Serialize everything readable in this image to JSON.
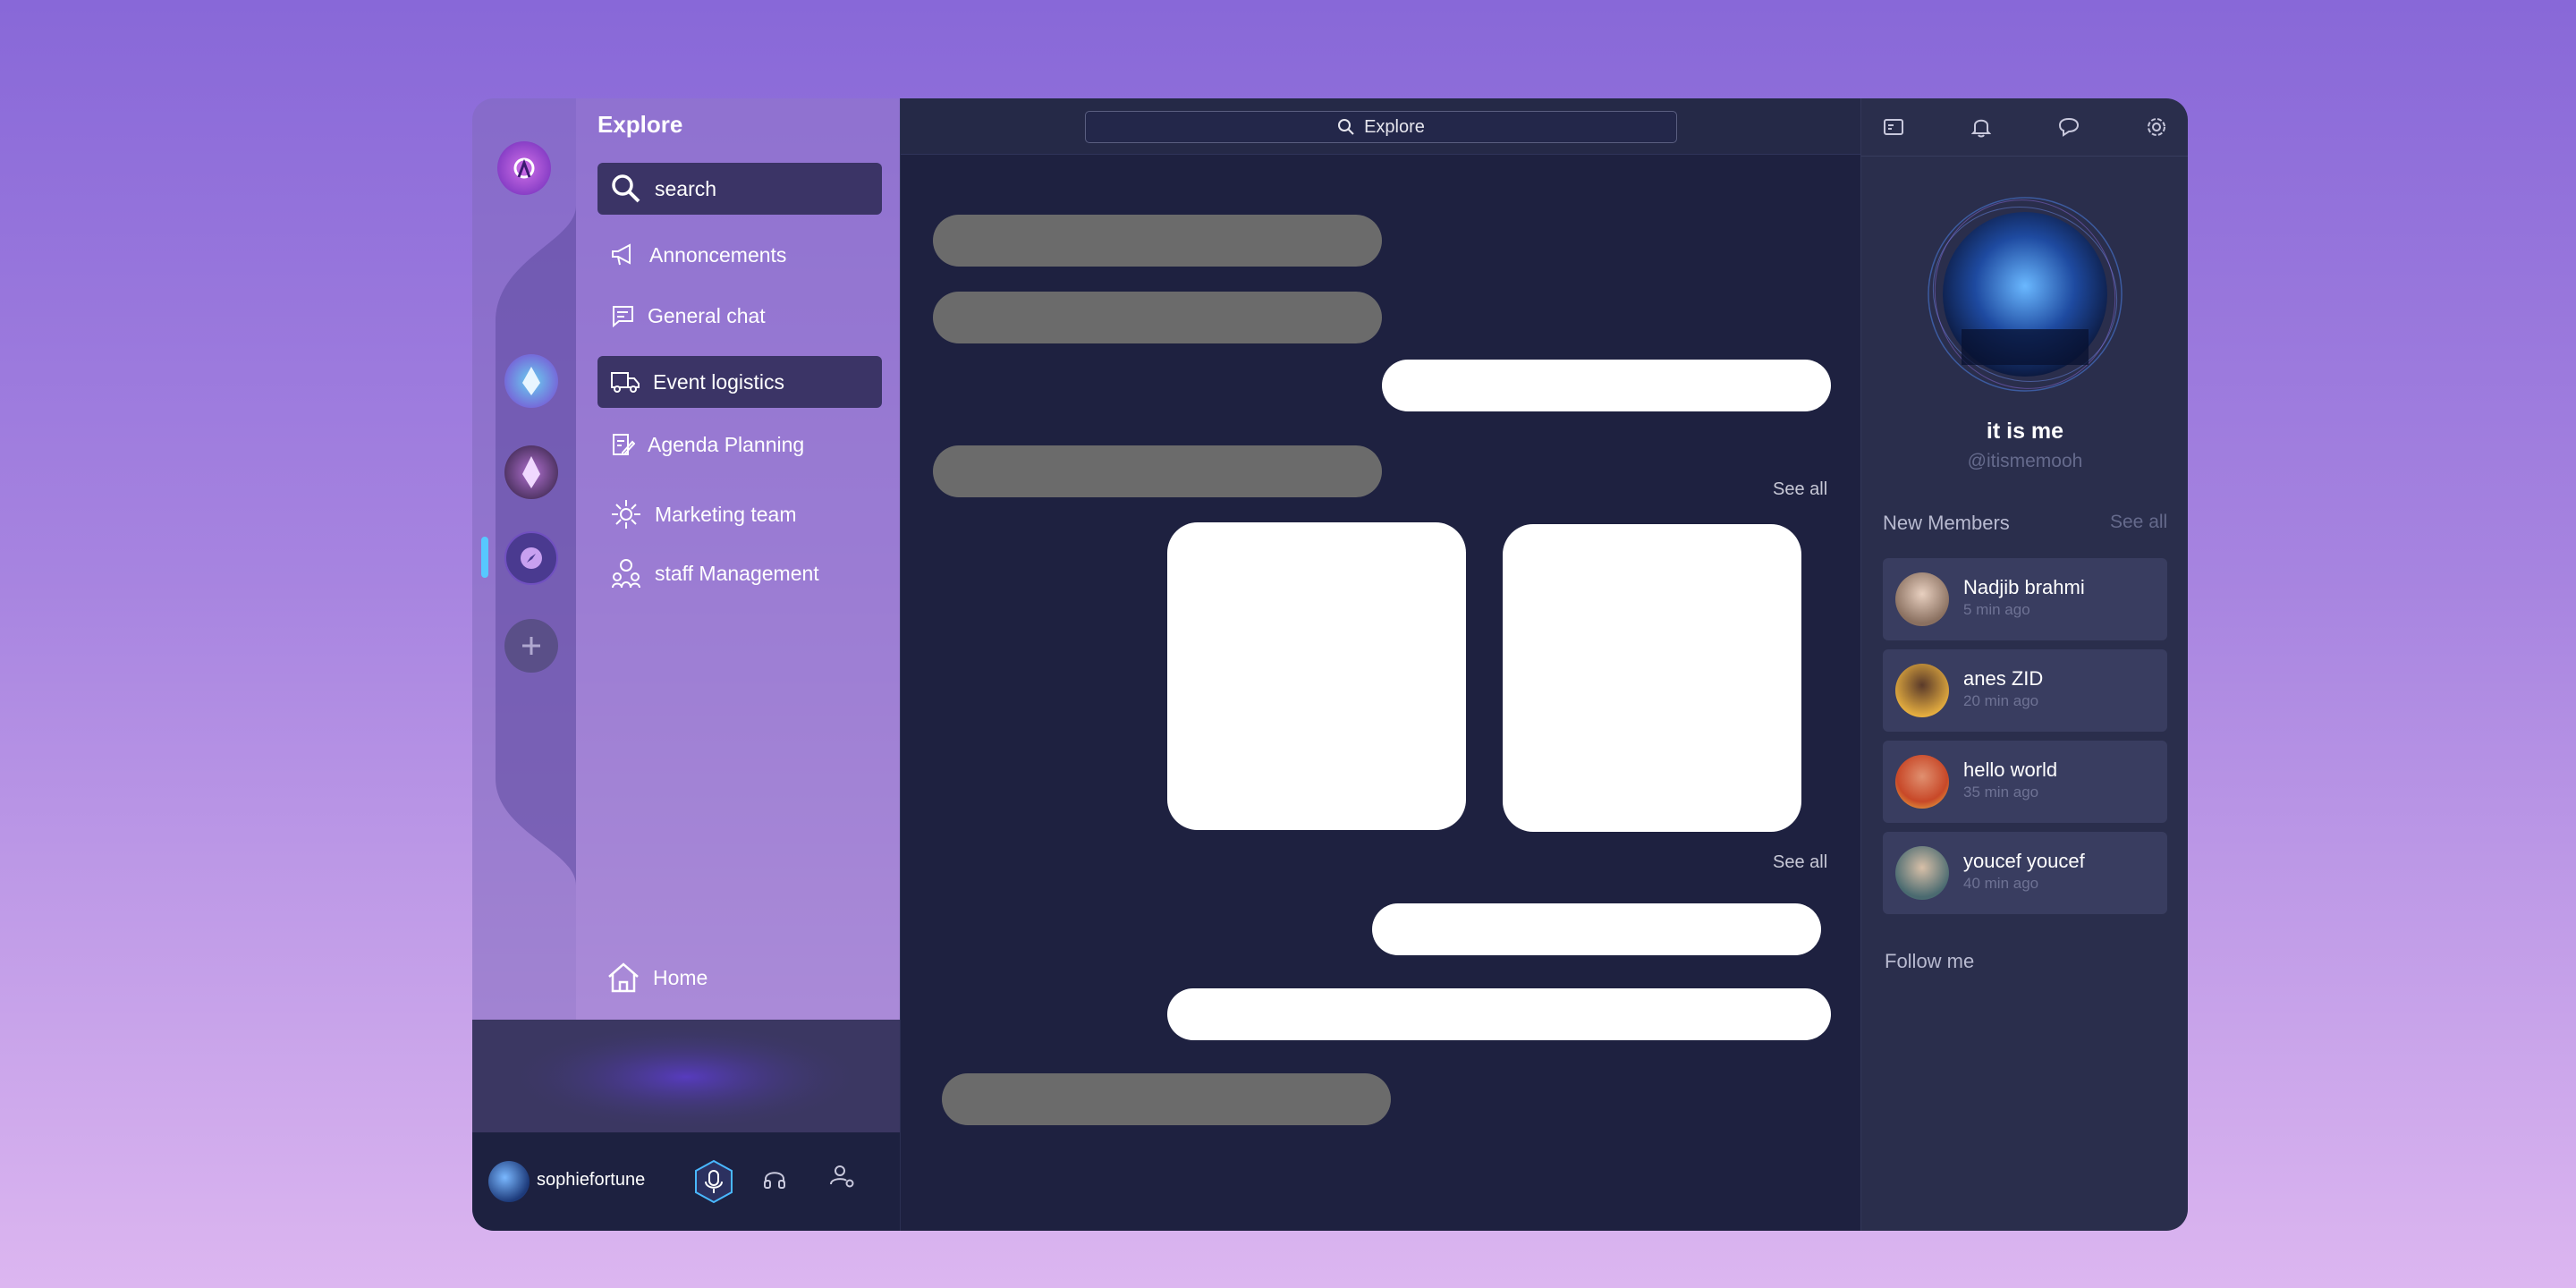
{
  "channels": {
    "title": "Explore",
    "search_label": "search",
    "items": [
      {
        "label": "Annoncements",
        "icon": "megaphone-icon"
      },
      {
        "label": "General chat",
        "icon": "chat-lines-icon"
      },
      {
        "label": "Event logistics",
        "icon": "truck-icon",
        "active": true
      },
      {
        "label": "Agenda Planning",
        "icon": "clipboard-edit-icon"
      },
      {
        "label": "Marketing team",
        "icon": "network-gear-icon"
      },
      {
        "label": "staff Management",
        "icon": "people-gear-icon"
      }
    ],
    "home_label": "Home"
  },
  "user": {
    "name": "sophiefortune"
  },
  "main": {
    "search_placeholder": "Explore",
    "see_all_1": "See all",
    "see_all_2": "See all"
  },
  "profile": {
    "name": "it is me",
    "handle": "@itismemooh",
    "new_members_title": "New Members",
    "see_all": "See all",
    "follow_label": "Follow me",
    "members": [
      {
        "name": "Nadjib brahmi",
        "time": "5 min ago"
      },
      {
        "name": "anes ZID",
        "time": "20 min ago"
      },
      {
        "name": "hello world",
        "time": "35 min ago"
      },
      {
        "name": "youcef youcef",
        "time": "40 min ago"
      }
    ]
  },
  "colors": {
    "accent": "#8868d8",
    "main_bg": "#1e2140",
    "panel_bg": "#2a2e4c",
    "active_channel": "#3b3466"
  }
}
